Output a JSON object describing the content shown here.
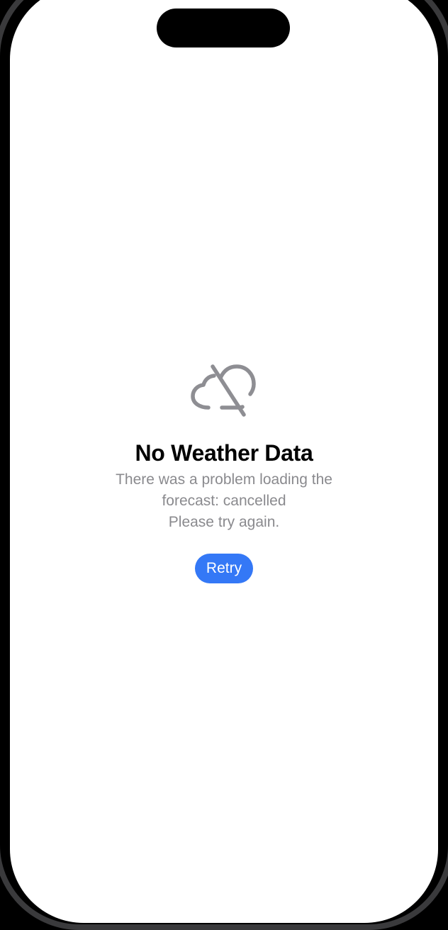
{
  "screen": {
    "icon": "cloud-slash-icon",
    "title": "No Weather Data",
    "message_line1": "There was a problem loading the forecast: cancelled",
    "message_line2": "Please try again.",
    "retry_label": "Retry"
  },
  "colors": {
    "background": "#ffffff",
    "title": "#000000",
    "message": "#8a8a8e",
    "icon": "#8e8e93",
    "accent": "#3478f6"
  }
}
